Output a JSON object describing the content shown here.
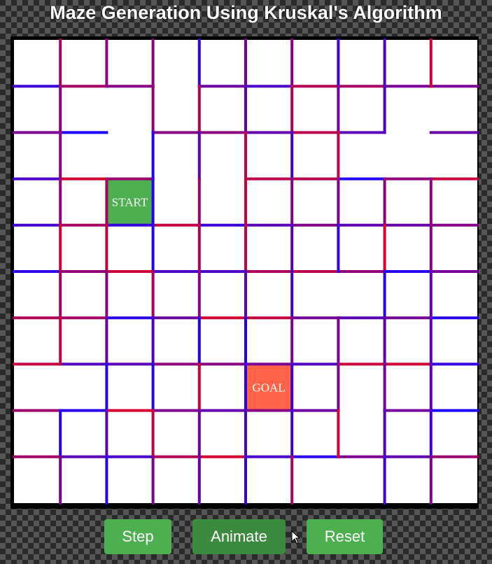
{
  "title": "Maze Generation Using Kruskal's Algorithm",
  "cells": {
    "start": "START",
    "goal": "GOAL"
  },
  "buttons": {
    "step": "Step",
    "animate": "Animate",
    "reset": "Reset"
  },
  "colors": {
    "start": "#4caf50",
    "goal": "#ff6347",
    "button": "#4caf50",
    "button_active": "#3b8a3e",
    "wall_blue": "#1a00ff",
    "wall_red": "#d6002e"
  },
  "maze": {
    "rows": 10,
    "cols": 10,
    "start_cell": [
      3,
      2
    ],
    "goal_cell": [
      7,
      5
    ]
  }
}
